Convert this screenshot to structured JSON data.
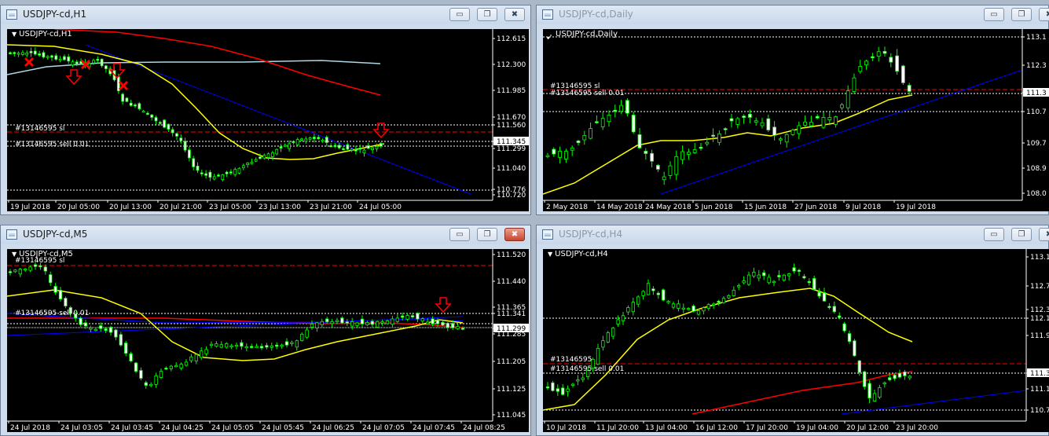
{
  "colors": {
    "background": "#000000",
    "bull_candle": "#00ff00",
    "bear_candle": "#ffffff",
    "ma_fast": "#ffff00",
    "ma_slow": "#ff0000",
    "ma_light": "#add8e6",
    "trendline": "#0000ff",
    "sl_line": "#ff0000",
    "entry_line": "#ffffff",
    "arrow_sell": "#ff0000"
  },
  "window_buttons": {
    "minimize": "▭",
    "restore": "❐",
    "close": "✖"
  },
  "windows": [
    {
      "id": "h1",
      "title": "USDJPY-cd,H1",
      "chart_label": "USDJPY-cd,H1",
      "axis_labels": [
        "112.615",
        "112.300",
        "111.985",
        "111.670",
        "111.560",
        "111.345",
        "111.299",
        "111.040",
        "110.776",
        "110.720"
      ],
      "time_labels": [
        "19 Jul 2018",
        "20 Jul 05:00",
        "20 Jul 13:00",
        "20 Jul 21:00",
        "23 Jul 05:00",
        "23 Jul 13:00",
        "23 Jul 21:00",
        "24 Jul 05:00"
      ],
      "order_labels": [
        "#13146595 sl",
        "#13146595 sell 0.01"
      ]
    },
    {
      "id": "daily",
      "title": "USDJPY-cd,Daily",
      "chart_label": "USDJPY-cd,Daily",
      "axis_labels": [
        "113.1",
        "112.3",
        "111.3",
        "110.7",
        "109.7",
        "108.9",
        "108.0"
      ],
      "time_labels": [
        "2 May 2018",
        "14 May 2018",
        "24 May 2018",
        "5 Jun 2018",
        "15 Jun 2018",
        "27 Jun 2018",
        "9 Jul 2018",
        "19 Jul 2018"
      ],
      "order_labels": [
        "#13146595 sl",
        "#13146595 sell 0.01"
      ]
    },
    {
      "id": "m5",
      "title": "USDJPY-cd,M5",
      "chart_label": "USDJPY-cd,M5",
      "axis_labels": [
        "111.520",
        "111.440",
        "111.365",
        "111.341",
        "111.299",
        "111.285",
        "111.205",
        "111.125",
        "111.045"
      ],
      "time_labels": [
        "24 Jul 2018",
        "24 Jul 03:05",
        "24 Jul 03:45",
        "24 Jul 04:25",
        "24 Jul 05:05",
        "24 Jul 05:45",
        "24 Jul 06:25",
        "24 Jul 07:05",
        "24 Jul 07:45",
        "24 Jul 08:25"
      ],
      "order_labels": [
        "#13146595 sl",
        "#13146595 sell 0.01"
      ]
    },
    {
      "id": "h4",
      "title": "USDJPY-cd,H4",
      "chart_label": "USDJPY-cd,H4",
      "axis_labels": [
        "113.1",
        "112.7",
        "112.3",
        "112.1",
        "111.9",
        "111.3",
        "111.1",
        "110.7"
      ],
      "time_labels": [
        "10 Jul 2018",
        "11 Jul 20:00",
        "13 Jul 04:00",
        "16 Jul 12:00",
        "17 Jul 20:00",
        "19 Jul 04:00",
        "20 Jul 12:00",
        "23 Jul 20:00"
      ],
      "order_labels": [
        "#13146595",
        "#13146595 sell 0.01"
      ]
    }
  ]
}
